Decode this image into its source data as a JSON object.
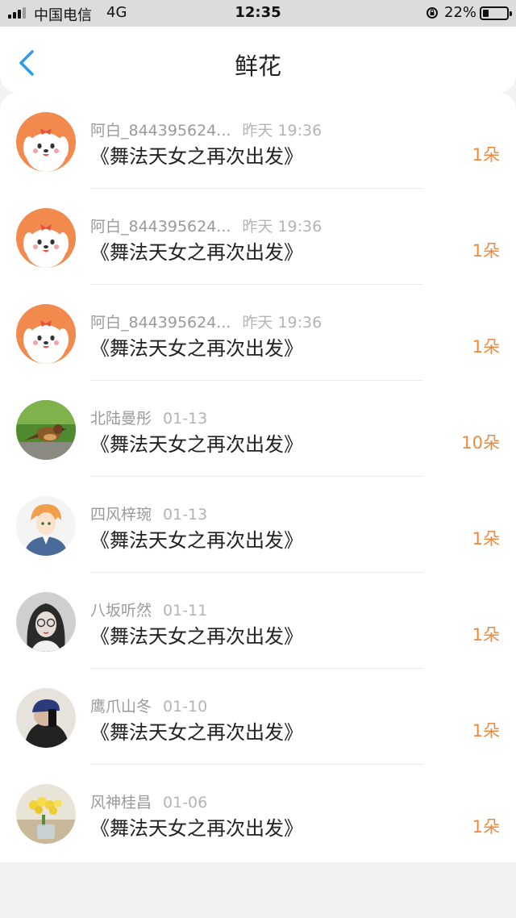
{
  "status_bar": {
    "carrier": "中国电信",
    "network": "4G",
    "time": "12:35",
    "battery_percent": "22%",
    "battery_level": 0.22,
    "signal_bars": 3
  },
  "nav": {
    "back_icon": "chevron-left-icon",
    "title": "鲜花"
  },
  "colors": {
    "accent_blue": "#2b9af3",
    "amount_orange": "#ef8a3c"
  },
  "flowers": [
    {
      "user": "阿白_844395624...",
      "time": "昨天 19:36",
      "work": "《舞法天女之再次出发》",
      "amount": "1朵",
      "avatar": "cartoon-dog-avatar"
    },
    {
      "user": "阿白_844395624...",
      "time": "昨天 19:36",
      "work": "《舞法天女之再次出发》",
      "amount": "1朵",
      "avatar": "cartoon-dog-avatar"
    },
    {
      "user": "阿白_844395624...",
      "time": "昨天 19:36",
      "work": "《舞法天女之再次出发》",
      "amount": "1朵",
      "avatar": "cartoon-dog-avatar"
    },
    {
      "user": "北陆曼彤",
      "time": "01-13",
      "work": "《舞法天女之再次出发》",
      "amount": "10朵",
      "avatar": "bird-photo-avatar"
    },
    {
      "user": "四风梓琬",
      "time": "01-13",
      "work": "《舞法天女之再次出发》",
      "amount": "1朵",
      "avatar": "anime-boy-avatar"
    },
    {
      "user": "八坂听然",
      "time": "01-11",
      "work": "《舞法天女之再次出发》",
      "amount": "1朵",
      "avatar": "girl-with-glasses-avatar"
    },
    {
      "user": "鹰爪山冬",
      "time": "01-10",
      "work": "《舞法天女之再次出发》",
      "amount": "1朵",
      "avatar": "person-with-cap-avatar"
    },
    {
      "user": "风神桂昌",
      "time": "01-06",
      "work": "《舞法天女之再次出发》",
      "amount": "1朵",
      "avatar": "flower-bouquet-avatar"
    }
  ]
}
